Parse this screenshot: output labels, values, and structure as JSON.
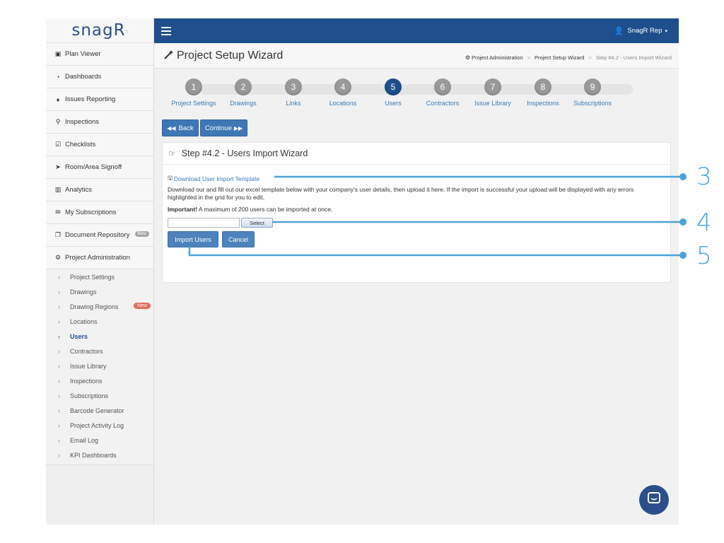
{
  "app": {
    "logo": "snagR",
    "logo_mark": "·"
  },
  "sidebar": {
    "items": [
      {
        "label": "Plan Viewer",
        "icon": "image-icon",
        "glyph": "▣"
      },
      {
        "label": "Dashboards",
        "icon": "dashboard-icon",
        "glyph": "◔"
      },
      {
        "label": "Issues Reporting",
        "icon": "map-marker-icon",
        "glyph": "♦"
      },
      {
        "label": "Inspections",
        "icon": "search-icon",
        "glyph": "⚲"
      },
      {
        "label": "Checklists",
        "icon": "checkbox-icon",
        "glyph": "☑"
      },
      {
        "label": "Room/Area Signoff",
        "icon": "location-arrow-icon",
        "glyph": "➤"
      },
      {
        "label": "Analytics",
        "icon": "bar-chart-icon",
        "glyph": "▥"
      },
      {
        "label": "My Subscriptions",
        "icon": "envelope-icon",
        "glyph": "✉"
      },
      {
        "label": "Document Repository",
        "icon": "copy-icon",
        "glyph": "❐",
        "badge": "Beta"
      }
    ],
    "admin": {
      "label": "Project Administration",
      "glyph": "⚙",
      "subitems": [
        {
          "label": "Project Settings"
        },
        {
          "label": "Drawings"
        },
        {
          "label": "Drawing Regions",
          "badge": "New"
        },
        {
          "label": "Locations"
        },
        {
          "label": "Users",
          "active": true
        },
        {
          "label": "Contractors"
        },
        {
          "label": "Issue Library"
        },
        {
          "label": "Inspections"
        },
        {
          "label": "Subscriptions"
        },
        {
          "label": "Barcode Generator"
        },
        {
          "label": "Project Activity Log"
        },
        {
          "label": "Email Log"
        },
        {
          "label": "KPI Dashboards"
        }
      ]
    }
  },
  "topbar": {
    "user_name": "SnagR Rep",
    "user_glyph": "👤",
    "caret": "▾"
  },
  "header": {
    "title": "Project Setup Wizard",
    "title_glyph": "🪄",
    "breadcrumbs": [
      "Project Administration",
      "Project Setup Wizard",
      "Step #4.2 - Users Import Wizard"
    ],
    "crumb_sep": ">"
  },
  "wizard": {
    "steps": [
      {
        "num": "1",
        "label": "Project Settings"
      },
      {
        "num": "2",
        "label": "Drawings"
      },
      {
        "num": "3",
        "label": "Links"
      },
      {
        "num": "4",
        "label": "Locations"
      },
      {
        "num": "5",
        "label": "Users",
        "active": true
      },
      {
        "num": "6",
        "label": "Contractors"
      },
      {
        "num": "7",
        "label": "Issue Library"
      },
      {
        "num": "8",
        "label": "Inspections"
      },
      {
        "num": "9",
        "label": "Subscriptions"
      }
    ],
    "back_label": "Back",
    "continue_label": "Continue"
  },
  "panel": {
    "title": "Step #4.2 - Users Import Wizard",
    "download_link": "Download User Import Template",
    "description": "Download our and fill out our excel template below with your company's user details, then upload it here. If the import is successful your upload will be displayed with any errors highlighted in the grid for you to edit.",
    "important_label": "Important!",
    "important_text": " A maximum of 200 users can be imported at once.",
    "select_label": "Select",
    "import_label": "Import Users",
    "cancel_label": "Cancel"
  },
  "annotations": {
    "callout_3": "3",
    "callout_4": "4",
    "callout_5": "5"
  },
  "colors": {
    "brand": "#1f4e8c",
    "accent": "#3f77b5",
    "callout": "#4aa3d8",
    "badge_new": "#e06a5a"
  }
}
